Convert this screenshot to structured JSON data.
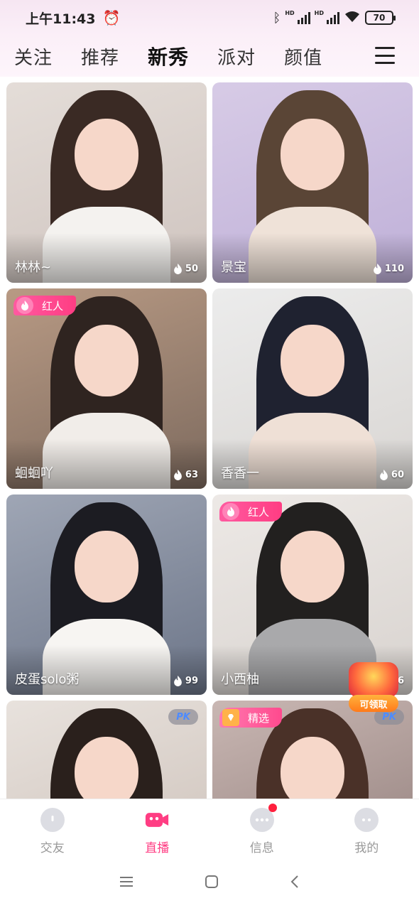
{
  "status": {
    "time": "上午11:43",
    "hd1": "HD",
    "hd2": "HD",
    "battery": "70"
  },
  "top_tabs": [
    {
      "label": "关注"
    },
    {
      "label": "推荐"
    },
    {
      "label": "新秀"
    },
    {
      "label": "派对"
    },
    {
      "label": "颜值"
    }
  ],
  "cards": [
    {
      "name": "林林~",
      "heat": "50"
    },
    {
      "name": "景宝",
      "heat": "110"
    },
    {
      "name": "蛔蛔吖",
      "heat": "63",
      "badge": "红人"
    },
    {
      "name": "香香一",
      "heat": "60"
    },
    {
      "name": "皮蛋solo粥",
      "heat": "99"
    },
    {
      "name": "小西柚",
      "heat": "6",
      "badge": "红人"
    },
    {
      "pk": "PK"
    },
    {
      "badge": "精选",
      "pk": "PK"
    }
  ],
  "gift": {
    "label": "可领取"
  },
  "bottom_nav": [
    {
      "label": "交友"
    },
    {
      "label": "直播"
    },
    {
      "label": "信息"
    },
    {
      "label": "我的"
    }
  ],
  "colors": {
    "accent": "#ff3d83",
    "inactive": "#999999"
  }
}
